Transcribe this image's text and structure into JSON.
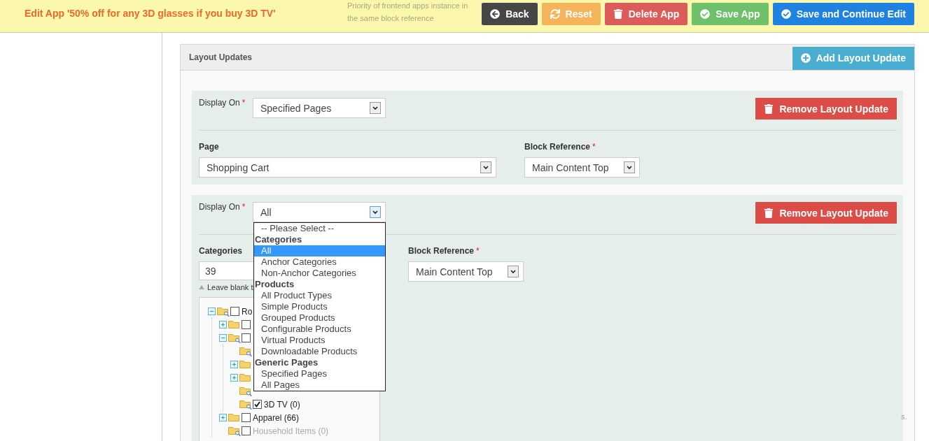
{
  "header": {
    "title": "Edit App '50% off for any 3D glasses if you buy 3D TV'",
    "faded_note": "Priority of frontend apps instance in the same block reference",
    "buttons": [
      {
        "label": "Back",
        "kind": "back"
      },
      {
        "label": "Reset",
        "kind": "reset"
      },
      {
        "label": "Delete App",
        "kind": "delete"
      },
      {
        "label": "Save App",
        "kind": "save"
      },
      {
        "label": "Save and Continue Edit",
        "kind": "continue"
      }
    ]
  },
  "panel": {
    "title": "Layout Updates",
    "add_button": "Add Layout Update",
    "updates": [
      {
        "display_on_label": "Display On",
        "display_on_mark": "*",
        "display_on": "Specified Pages",
        "dropdown_open": false,
        "remove_button": "Remove Layout Update",
        "kind": "page",
        "page_label": "Page",
        "page": "Shopping Cart",
        "block_label": "Block Reference",
        "block_mark": "*",
        "block": "Main Content Top"
      },
      {
        "display_on_label": "Display On",
        "display_on_mark": "*",
        "display_on": "All",
        "dropdown_open": true,
        "remove_button": "Remove Layout Update",
        "kind": "categories",
        "categories_label": "Categories",
        "categories": "39",
        "hint": "Leave blank t",
        "block_label": "Block Reference",
        "block_mark": "*",
        "block": "Main Content Top",
        "options": [
          {
            "kind": "option",
            "label": "-- Please Select --",
            "selected": false
          },
          {
            "kind": "group",
            "label": "Categories"
          },
          {
            "kind": "option",
            "label": "All",
            "selected": true
          },
          {
            "kind": "option",
            "label": "Anchor Categories",
            "selected": false
          },
          {
            "kind": "option",
            "label": "Non-Anchor Categories",
            "selected": false
          },
          {
            "kind": "group",
            "label": "Products"
          },
          {
            "kind": "option",
            "label": "All Product Types",
            "selected": false
          },
          {
            "kind": "option",
            "label": "Simple Products",
            "selected": false
          },
          {
            "kind": "option",
            "label": "Grouped Products",
            "selected": false
          },
          {
            "kind": "option",
            "label": "Configurable Products",
            "selected": false
          },
          {
            "kind": "option",
            "label": "Virtual Products",
            "selected": false
          },
          {
            "kind": "option",
            "label": "Downloadable Products",
            "selected": false
          },
          {
            "kind": "group",
            "label": "Generic Pages"
          },
          {
            "kind": "option",
            "label": "Specified Pages",
            "selected": false
          },
          {
            "kind": "option",
            "label": "All Pages",
            "selected": false
          }
        ],
        "tree": [
          {
            "kind": "branch",
            "label": "Ro",
            "checked": false,
            "expanded": true,
            "children": [
              {
                "kind": "branch",
                "checked": false,
                "expanded": false
              },
              {
                "kind": "branch",
                "checked": false,
                "expanded": true,
                "children": [
                  {
                    "kind": "leaf"
                  },
                  {
                    "kind": "branch",
                    "expanded": false
                  },
                  {
                    "kind": "branch",
                    "expanded": false
                  },
                  {
                    "kind": "leaf"
                  },
                  {
                    "kind": "leaf",
                    "label": "3D TV (0)",
                    "checked": true,
                    "disabled": false
                  }
                ]
              },
              {
                "kind": "branch",
                "label": "Apparel (66)",
                "checked": false,
                "expanded": false,
                "disabled": false
              },
              {
                "kind": "leaf",
                "label": "Household Items (0)",
                "checked": false,
                "disabled": true
              }
            ]
          }
        ]
      }
    ]
  },
  "side_note": "s."
}
